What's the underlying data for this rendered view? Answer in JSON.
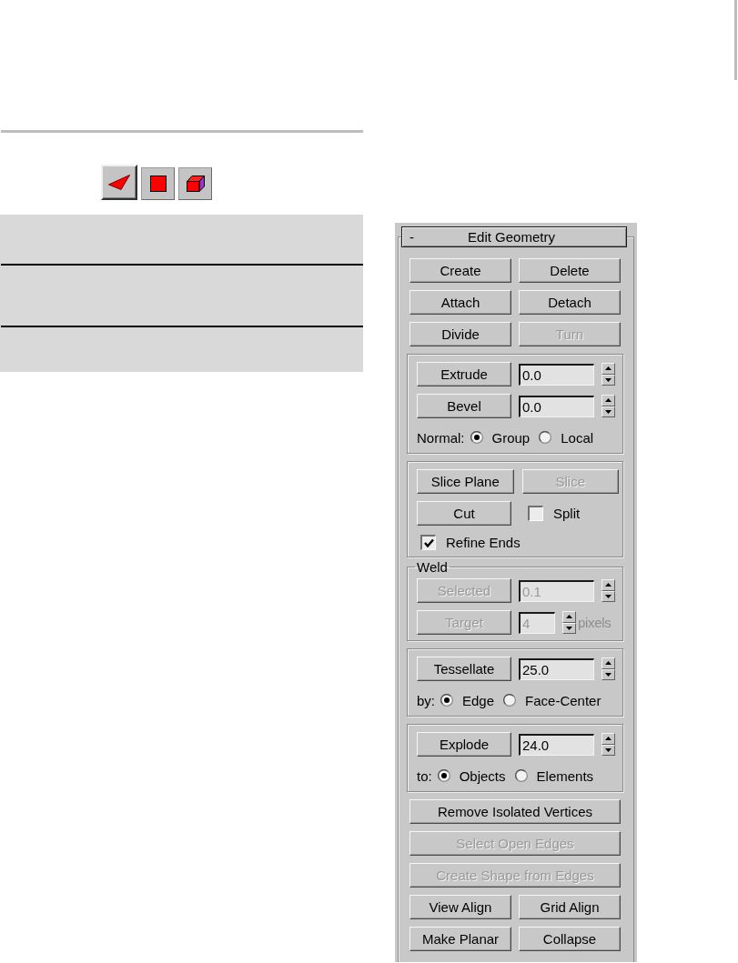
{
  "subobject_toolbar": [
    {
      "kind": "triangle",
      "selected": true
    },
    {
      "kind": "square",
      "selected": false
    },
    {
      "kind": "cube",
      "selected": false
    }
  ],
  "rollout": {
    "toggle": "-",
    "title": "Edit Geometry",
    "items": [
      {
        "kind": "buttons",
        "buttons": [
          {
            "label": "Create",
            "disabled": false
          },
          {
            "label": "Delete",
            "disabled": false
          }
        ]
      },
      {
        "kind": "buttons",
        "buttons": [
          {
            "label": "Attach",
            "disabled": false
          },
          {
            "label": "Detach",
            "disabled": false
          }
        ]
      },
      {
        "kind": "buttons",
        "buttons": [
          {
            "label": "Divide",
            "disabled": false
          },
          {
            "label": "Turn",
            "disabled": true
          }
        ]
      },
      {
        "kind": "group",
        "rows": [
          {
            "kind": "spinner",
            "button": {
              "label": "Extrude",
              "disabled": false
            },
            "value": "0.0",
            "disabled": false
          },
          {
            "kind": "spinner",
            "button": {
              "label": "Bevel",
              "disabled": false
            },
            "value": "0.0",
            "disabled": false
          },
          {
            "kind": "radios",
            "label": "Normal:",
            "options": [
              {
                "label": "Group",
                "selected": true
              },
              {
                "label": "Local",
                "selected": false
              }
            ]
          }
        ]
      },
      {
        "kind": "group",
        "rows": [
          {
            "kind": "buttons",
            "buttons": [
              {
                "label": "Slice Plane",
                "disabled": false
              },
              {
                "label": "Slice",
                "disabled": true
              }
            ]
          },
          {
            "kind": "button_check",
            "button": {
              "label": "Cut",
              "disabled": false
            },
            "checkbox": {
              "label": "Split",
              "checked": false
            }
          },
          {
            "kind": "checkbox",
            "label": "Refine Ends",
            "checked": true
          }
        ]
      },
      {
        "kind": "group",
        "title": "Weld",
        "rows": [
          {
            "kind": "spinner",
            "button": {
              "label": "Selected",
              "disabled": true
            },
            "value": "0.1",
            "disabled": true
          },
          {
            "kind": "spinner",
            "button": {
              "label": "Target",
              "disabled": true
            },
            "value": "4",
            "disabled": true,
            "unit": "pixels"
          }
        ]
      },
      {
        "kind": "group",
        "rows": [
          {
            "kind": "spinner",
            "button": {
              "label": "Tessellate",
              "disabled": false
            },
            "value": "25.0",
            "disabled": false
          },
          {
            "kind": "radios",
            "label": "by:",
            "options": [
              {
                "label": "Edge",
                "selected": true
              },
              {
                "label": "Face-Center",
                "selected": false
              }
            ]
          }
        ]
      },
      {
        "kind": "group",
        "rows": [
          {
            "kind": "spinner",
            "button": {
              "label": "Explode",
              "disabled": false
            },
            "value": "24.0",
            "disabled": false
          },
          {
            "kind": "radios",
            "label": "to:",
            "options": [
              {
                "label": "Objects",
                "selected": true
              },
              {
                "label": "Elements",
                "selected": false
              }
            ]
          }
        ]
      },
      {
        "kind": "buttons",
        "buttons": [
          {
            "label": "Remove Isolated Vertices",
            "disabled": false
          }
        ]
      },
      {
        "kind": "buttons",
        "buttons": [
          {
            "label": "Select Open Edges",
            "disabled": true
          }
        ]
      },
      {
        "kind": "buttons",
        "buttons": [
          {
            "label": "Create Shape from Edges",
            "disabled": true
          }
        ]
      },
      {
        "kind": "buttons",
        "buttons": [
          {
            "label": "View Align",
            "disabled": false
          },
          {
            "label": "Grid Align",
            "disabled": false
          }
        ]
      },
      {
        "kind": "buttons",
        "buttons": [
          {
            "label": "Make Planar",
            "disabled": false
          },
          {
            "label": "Collapse",
            "disabled": false
          }
        ]
      }
    ]
  }
}
